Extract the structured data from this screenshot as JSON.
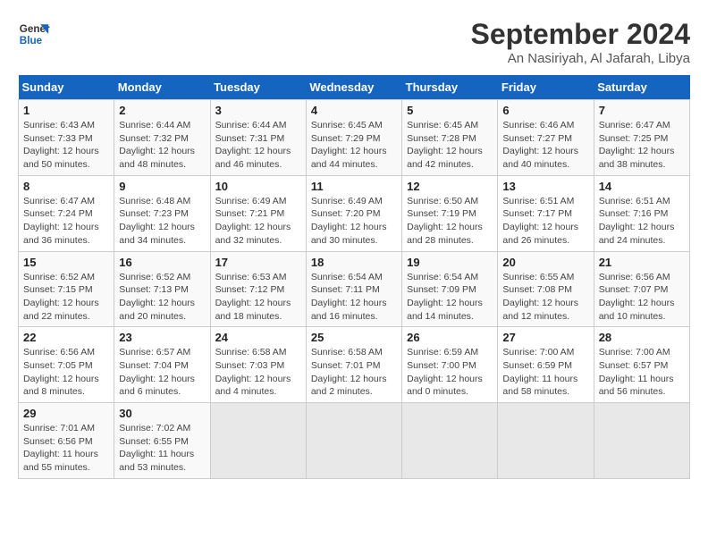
{
  "header": {
    "logo_line1": "General",
    "logo_line2": "Blue",
    "title": "September 2024",
    "subtitle": "An Nasiriyah, Al Jafarah, Libya"
  },
  "days_of_week": [
    "Sunday",
    "Monday",
    "Tuesday",
    "Wednesday",
    "Thursday",
    "Friday",
    "Saturday"
  ],
  "weeks": [
    [
      {
        "day": "1",
        "lines": [
          "Sunrise: 6:43 AM",
          "Sunset: 7:33 PM",
          "Daylight: 12 hours",
          "and 50 minutes."
        ]
      },
      {
        "day": "2",
        "lines": [
          "Sunrise: 6:44 AM",
          "Sunset: 7:32 PM",
          "Daylight: 12 hours",
          "and 48 minutes."
        ]
      },
      {
        "day": "3",
        "lines": [
          "Sunrise: 6:44 AM",
          "Sunset: 7:31 PM",
          "Daylight: 12 hours",
          "and 46 minutes."
        ]
      },
      {
        "day": "4",
        "lines": [
          "Sunrise: 6:45 AM",
          "Sunset: 7:29 PM",
          "Daylight: 12 hours",
          "and 44 minutes."
        ]
      },
      {
        "day": "5",
        "lines": [
          "Sunrise: 6:45 AM",
          "Sunset: 7:28 PM",
          "Daylight: 12 hours",
          "and 42 minutes."
        ]
      },
      {
        "day": "6",
        "lines": [
          "Sunrise: 6:46 AM",
          "Sunset: 7:27 PM",
          "Daylight: 12 hours",
          "and 40 minutes."
        ]
      },
      {
        "day": "7",
        "lines": [
          "Sunrise: 6:47 AM",
          "Sunset: 7:25 PM",
          "Daylight: 12 hours",
          "and 38 minutes."
        ]
      }
    ],
    [
      {
        "day": "8",
        "lines": [
          "Sunrise: 6:47 AM",
          "Sunset: 7:24 PM",
          "Daylight: 12 hours",
          "and 36 minutes."
        ]
      },
      {
        "day": "9",
        "lines": [
          "Sunrise: 6:48 AM",
          "Sunset: 7:23 PM",
          "Daylight: 12 hours",
          "and 34 minutes."
        ]
      },
      {
        "day": "10",
        "lines": [
          "Sunrise: 6:49 AM",
          "Sunset: 7:21 PM",
          "Daylight: 12 hours",
          "and 32 minutes."
        ]
      },
      {
        "day": "11",
        "lines": [
          "Sunrise: 6:49 AM",
          "Sunset: 7:20 PM",
          "Daylight: 12 hours",
          "and 30 minutes."
        ]
      },
      {
        "day": "12",
        "lines": [
          "Sunrise: 6:50 AM",
          "Sunset: 7:19 PM",
          "Daylight: 12 hours",
          "and 28 minutes."
        ]
      },
      {
        "day": "13",
        "lines": [
          "Sunrise: 6:51 AM",
          "Sunset: 7:17 PM",
          "Daylight: 12 hours",
          "and 26 minutes."
        ]
      },
      {
        "day": "14",
        "lines": [
          "Sunrise: 6:51 AM",
          "Sunset: 7:16 PM",
          "Daylight: 12 hours",
          "and 24 minutes."
        ]
      }
    ],
    [
      {
        "day": "15",
        "lines": [
          "Sunrise: 6:52 AM",
          "Sunset: 7:15 PM",
          "Daylight: 12 hours",
          "and 22 minutes."
        ]
      },
      {
        "day": "16",
        "lines": [
          "Sunrise: 6:52 AM",
          "Sunset: 7:13 PM",
          "Daylight: 12 hours",
          "and 20 minutes."
        ]
      },
      {
        "day": "17",
        "lines": [
          "Sunrise: 6:53 AM",
          "Sunset: 7:12 PM",
          "Daylight: 12 hours",
          "and 18 minutes."
        ]
      },
      {
        "day": "18",
        "lines": [
          "Sunrise: 6:54 AM",
          "Sunset: 7:11 PM",
          "Daylight: 12 hours",
          "and 16 minutes."
        ]
      },
      {
        "day": "19",
        "lines": [
          "Sunrise: 6:54 AM",
          "Sunset: 7:09 PM",
          "Daylight: 12 hours",
          "and 14 minutes."
        ]
      },
      {
        "day": "20",
        "lines": [
          "Sunrise: 6:55 AM",
          "Sunset: 7:08 PM",
          "Daylight: 12 hours",
          "and 12 minutes."
        ]
      },
      {
        "day": "21",
        "lines": [
          "Sunrise: 6:56 AM",
          "Sunset: 7:07 PM",
          "Daylight: 12 hours",
          "and 10 minutes."
        ]
      }
    ],
    [
      {
        "day": "22",
        "lines": [
          "Sunrise: 6:56 AM",
          "Sunset: 7:05 PM",
          "Daylight: 12 hours",
          "and 8 minutes."
        ]
      },
      {
        "day": "23",
        "lines": [
          "Sunrise: 6:57 AM",
          "Sunset: 7:04 PM",
          "Daylight: 12 hours",
          "and 6 minutes."
        ]
      },
      {
        "day": "24",
        "lines": [
          "Sunrise: 6:58 AM",
          "Sunset: 7:03 PM",
          "Daylight: 12 hours",
          "and 4 minutes."
        ]
      },
      {
        "day": "25",
        "lines": [
          "Sunrise: 6:58 AM",
          "Sunset: 7:01 PM",
          "Daylight: 12 hours",
          "and 2 minutes."
        ]
      },
      {
        "day": "26",
        "lines": [
          "Sunrise: 6:59 AM",
          "Sunset: 7:00 PM",
          "Daylight: 12 hours",
          "and 0 minutes."
        ]
      },
      {
        "day": "27",
        "lines": [
          "Sunrise: 7:00 AM",
          "Sunset: 6:59 PM",
          "Daylight: 11 hours",
          "and 58 minutes."
        ]
      },
      {
        "day": "28",
        "lines": [
          "Sunrise: 7:00 AM",
          "Sunset: 6:57 PM",
          "Daylight: 11 hours",
          "and 56 minutes."
        ]
      }
    ],
    [
      {
        "day": "29",
        "lines": [
          "Sunrise: 7:01 AM",
          "Sunset: 6:56 PM",
          "Daylight: 11 hours",
          "and 55 minutes."
        ]
      },
      {
        "day": "30",
        "lines": [
          "Sunrise: 7:02 AM",
          "Sunset: 6:55 PM",
          "Daylight: 11 hours",
          "and 53 minutes."
        ]
      },
      {
        "day": "",
        "lines": [],
        "empty": true
      },
      {
        "day": "",
        "lines": [],
        "empty": true
      },
      {
        "day": "",
        "lines": [],
        "empty": true
      },
      {
        "day": "",
        "lines": [],
        "empty": true
      },
      {
        "day": "",
        "lines": [],
        "empty": true
      }
    ]
  ]
}
